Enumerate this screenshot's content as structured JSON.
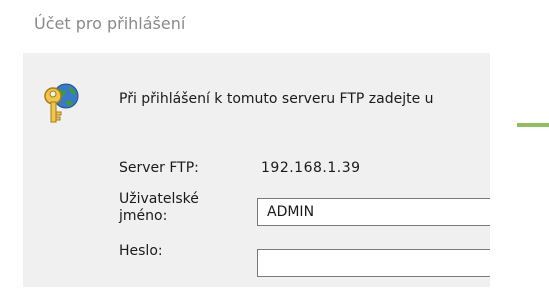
{
  "dialog": {
    "title": "Účet pro přihlášení",
    "intro": "Při přihlášení k tomuto serveru FTP zadejte u"
  },
  "icons": {
    "credentials": "key-globe-icon"
  },
  "form": {
    "server_label": "Server FTP:",
    "server_value": "192.168.1.39",
    "username_label_line1": "Uživatelské",
    "username_label_line2": "jméno:",
    "username_value": "ADMIN",
    "password_label": "Heslo:",
    "password_value": ""
  },
  "colors": {
    "accent_line": "#8fbf5a",
    "panel_background": "#f0f0f0"
  }
}
